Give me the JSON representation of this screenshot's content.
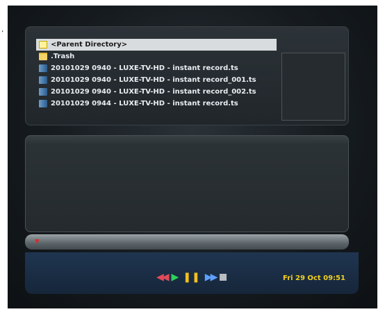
{
  "file_browser": {
    "items": [
      {
        "label": "<Parent Directory>",
        "icon": "parent-directory-icon"
      },
      {
        "label": ".Trash",
        "icon": "folder-icon"
      },
      {
        "label": "20101029 0940 - LUXE-TV-HD - instant record.ts",
        "icon": "video-file-icon"
      },
      {
        "label": "20101029 0940 - LUXE-TV-HD - instant record_001.ts",
        "icon": "video-file-icon"
      },
      {
        "label": "20101029 0940 - LUXE-TV-HD - instant record_002.ts",
        "icon": "video-file-icon"
      },
      {
        "label": "20101029 0944 - LUXE-TV-HD - instant record.ts",
        "icon": "video-file-icon"
      }
    ]
  },
  "status": {
    "clock": "Fri 29 Oct  09:51"
  },
  "colors": {
    "rewind": "#e04a5a",
    "play": "#2fd05a",
    "pause": "#f0c020",
    "fast_forward": "#5fa0ff",
    "stop": "#b8bcc0",
    "clock": "#f2d020"
  }
}
